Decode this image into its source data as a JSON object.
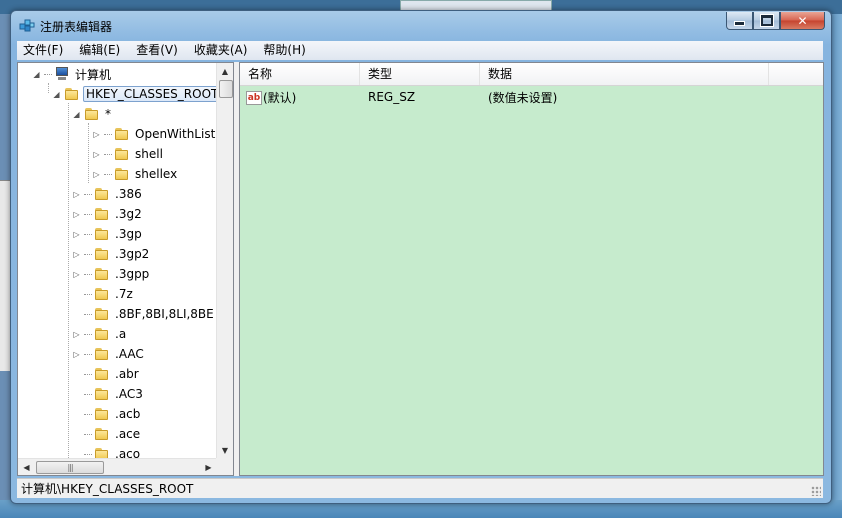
{
  "window": {
    "title": "注册表编辑器"
  },
  "menu": [
    "文件(F)",
    "编辑(E)",
    "查看(V)",
    "收藏夹(A)",
    "帮助(H)"
  ],
  "tree": {
    "root": "计算机",
    "selected": "HKEY_CLASSES_ROOT",
    "star": "*",
    "star_children": [
      "OpenWithList",
      "shell",
      "shellex"
    ],
    "keys": [
      ".386",
      ".3g2",
      ".3gp",
      ".3gp2",
      ".3gpp",
      ".7z",
      ".8BF,8BI,8LI,8BE",
      ".a",
      ".AAC",
      ".abr",
      ".AC3",
      ".acb",
      ".ace",
      ".aco"
    ]
  },
  "list": {
    "columns": [
      "名称",
      "类型",
      "数据"
    ],
    "rows": [
      {
        "name": "(默认)",
        "type": "REG_SZ",
        "data": "(数值未设置)",
        "icon": "string-value-icon"
      }
    ]
  },
  "status": {
    "path": "计算机\\HKEY_CLASSES_ROOT"
  },
  "colors": {
    "list_background": "#c6ebcd",
    "selection_border": "#7da2ce"
  }
}
